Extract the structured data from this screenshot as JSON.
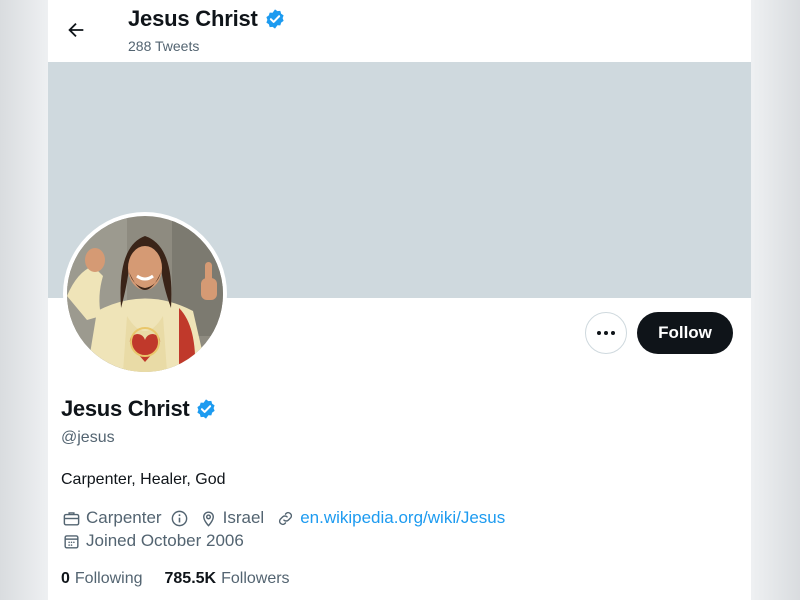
{
  "header": {
    "name": "Jesus Christ",
    "tweet_count": "288 Tweets"
  },
  "profile": {
    "name": "Jesus Christ",
    "handle": "@jesus",
    "bio": "Carpenter, Healer, God",
    "profession": "Carpenter",
    "location": "Israel",
    "website": "en.wikipedia.org/wiki/Jesus",
    "joined": "Joined October 2006",
    "following_count": "0",
    "following_label": "Following",
    "followers_count": "785.5K",
    "followers_label": "Followers",
    "verified": true
  },
  "actions": {
    "follow_label": "Follow",
    "more_label": "···"
  },
  "colors": {
    "banner": "#cfd9de",
    "verified_blue": "#1d9bf0",
    "follow_bg": "#0f1419",
    "secondary_text": "#536471"
  },
  "icons": [
    "back-arrow-icon",
    "verified-badge-icon",
    "more-icon",
    "briefcase-icon",
    "info-icon",
    "location-pin-icon",
    "link-icon",
    "calendar-icon"
  ]
}
